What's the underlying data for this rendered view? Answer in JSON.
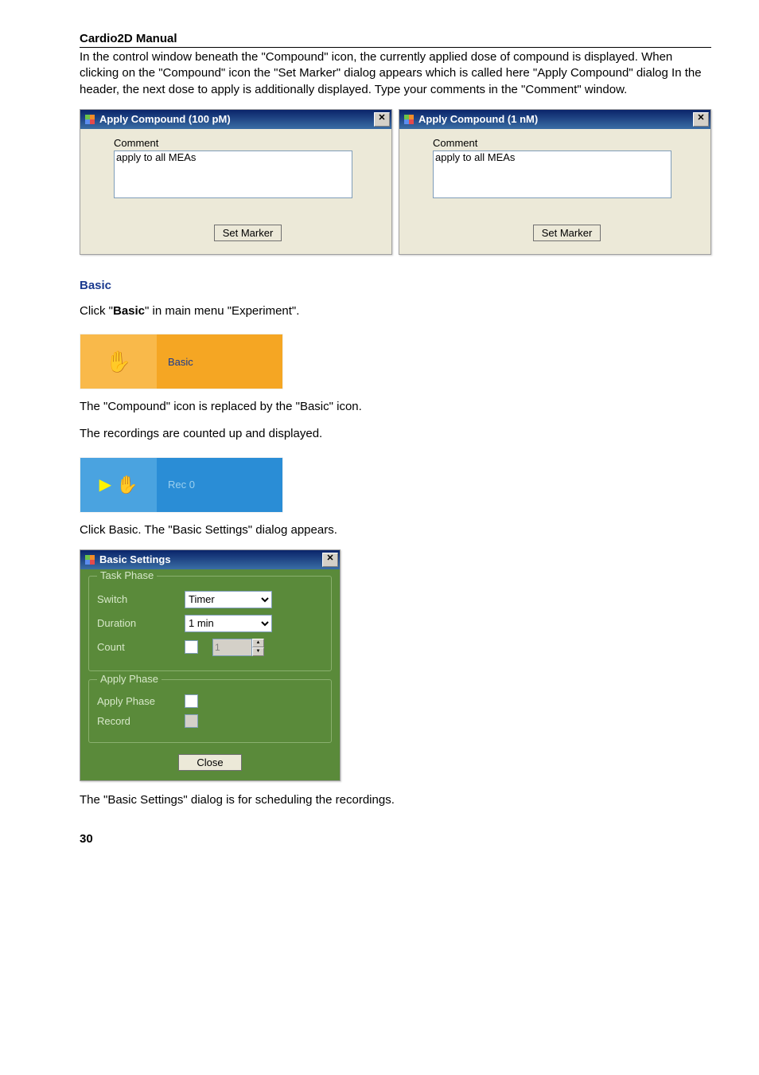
{
  "header": {
    "title": "Cardio2D Manual"
  },
  "intro_paragraph": "In the control window beneath the \"Compound\" icon, the currently applied dose of compound is displayed. When clicking on the \"Compound\" icon the \"Set Marker\" dialog appears which is called here \"Apply Compound\" dialog In the header, the next dose to apply is additionally displayed. Type your comments in the \"Comment\" window.",
  "dialog_left": {
    "title": "Apply Compound (100 pM)",
    "comment_label": "Comment",
    "comment_value": "apply to all MEAs",
    "button": "Set Marker"
  },
  "dialog_right": {
    "title": "Apply Compound (1 nM)",
    "comment_label": "Comment",
    "comment_value": "apply to all MEAs",
    "button": "Set Marker"
  },
  "basic_section": {
    "heading": "Basic",
    "line1_pre": "Click \"",
    "line1_bold": "Basic",
    "line1_post": "\" in main menu \"Experiment\".",
    "ribbon1_label": "Basic",
    "line2": "The \"Compound\" icon is replaced by the \"Basic\" icon.",
    "line3": "The recordings are counted up and displayed.",
    "ribbon2_label": "Rec 0",
    "line4": "Click Basic. The \"Basic Settings\" dialog appears."
  },
  "settings_dialog": {
    "title": "Basic Settings",
    "group1": "Task Phase",
    "switch_label": "Switch",
    "switch_value": "Timer",
    "duration_label": "Duration",
    "duration_value": "1 min",
    "count_label": "Count",
    "count_value": "1",
    "group2": "Apply Phase",
    "applyphase_label": "Apply Phase",
    "record_label": "Record",
    "close_btn": "Close"
  },
  "after_settings": "The \"Basic Settings\" dialog is for scheduling the recordings.",
  "page_number": "30"
}
